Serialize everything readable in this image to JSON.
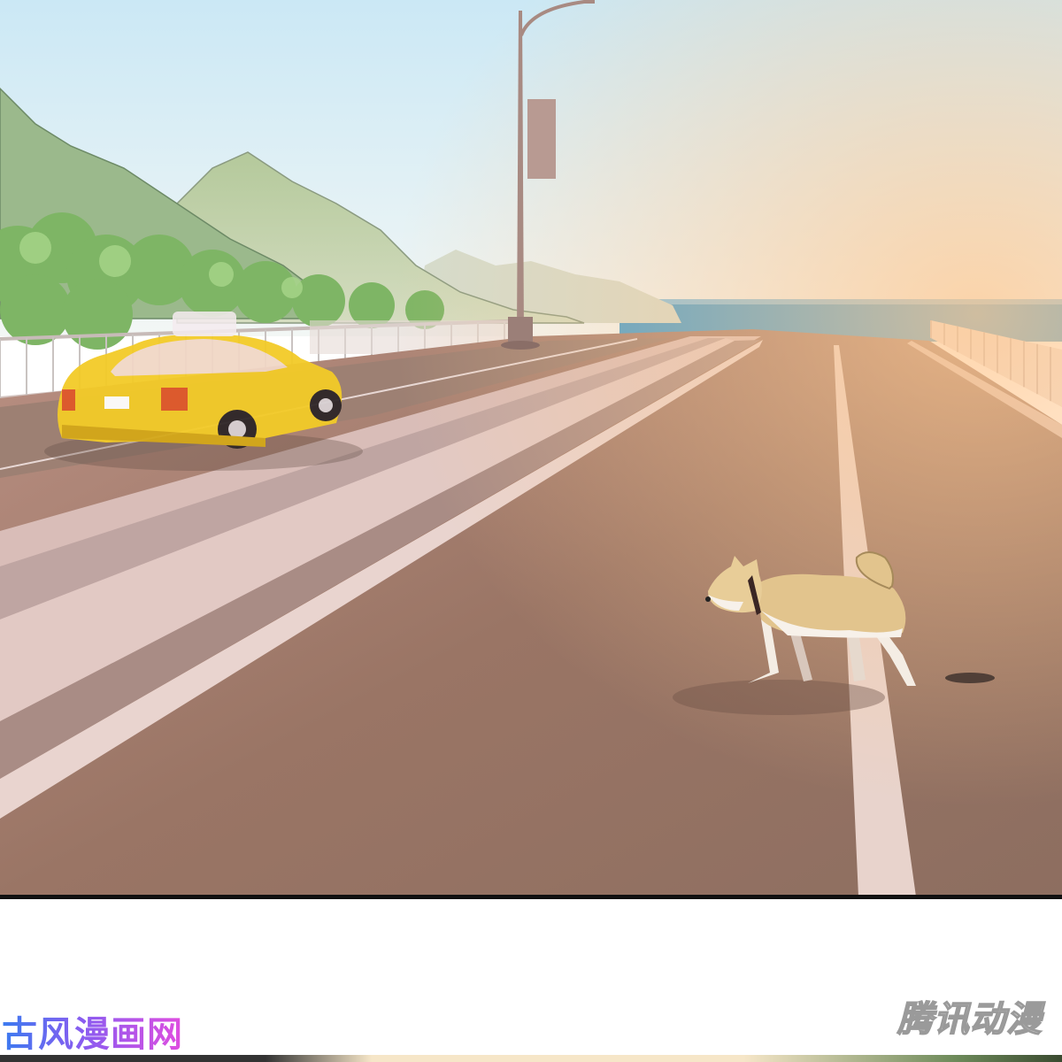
{
  "watermarks": {
    "left": "古风漫画网",
    "right": "腾讯动漫"
  },
  "colors": {
    "sky_top": "#cfeaf6",
    "sky_bottom": "#eef6f8",
    "sea": "#3d9fd0",
    "road": "#9c7766",
    "taxi": "#f4cf2a",
    "dog": "#e2c58e",
    "divider": "#d9b9b4"
  }
}
